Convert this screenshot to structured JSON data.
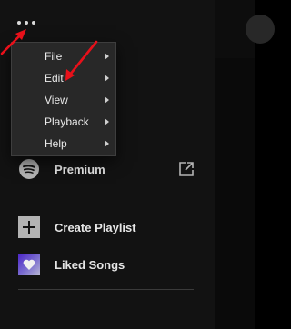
{
  "colors": {
    "sidebar_bg": "#121212",
    "menu_bg": "#282828",
    "text_primary": "#e6e6e6",
    "annotation_arrow": "#e8101a"
  },
  "top_bar": {
    "more_button_icon": "more-horizontal-icon"
  },
  "context_menu": {
    "items": [
      {
        "label": "File",
        "icon": "chevron-right-icon"
      },
      {
        "label": "Edit",
        "icon": "chevron-right-icon"
      },
      {
        "label": "View",
        "icon": "chevron-right-icon"
      },
      {
        "label": "Playback",
        "icon": "chevron-right-icon"
      },
      {
        "label": "Help",
        "icon": "chevron-right-icon"
      }
    ]
  },
  "nav": {
    "library_label_partial": "ry",
    "library_icon": "library-icon",
    "premium_label": "Premium",
    "premium_icon": "spotify-logo-icon",
    "premium_external_icon": "external-link-icon"
  },
  "playlists": {
    "create_label": "Create Playlist",
    "create_icon": "plus-icon",
    "liked_label": "Liked Songs",
    "liked_icon": "heart-icon"
  },
  "annotations": {
    "arrows": [
      "red-arrow-to-more-button",
      "red-arrow-to-edit"
    ]
  }
}
